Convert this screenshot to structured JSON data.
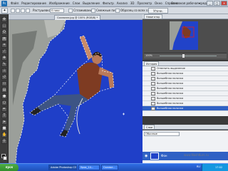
{
  "app": {
    "logo": "Ps",
    "menu": [
      "Файл",
      "Редактирование",
      "Изображение",
      "Слои",
      "Выделение",
      "Фильтр",
      "Анализ",
      "3D",
      "Просмотр",
      "Окно",
      "Справка"
    ],
    "workspace": "Основная рабочая среда",
    "window_buttons": [
      "_",
      "□",
      "×"
    ]
  },
  "options_bar": {
    "feather_label": "Растушевка:",
    "feather_value": "0 пикс",
    "antialias_label": "Сглаживание",
    "contiguous_label": "Смежные пикс.",
    "sample_all_label": "Образец со всех слоев",
    "refine_button": "Уточн. край..."
  },
  "document": {
    "tab_title": "Скалолаз.jpg @ 100% (RGB/8) *"
  },
  "navigator": {
    "tab": "Навигатор",
    "zoom": "100%"
  },
  "history": {
    "tab": "История",
    "items": [
      "Отменить выделение",
      "Волшебная палочка",
      "Волшебная палочка",
      "Волшебная палочка",
      "Волшебная палочка",
      "Волшебная палочка",
      "Волшебная палочка",
      "Волшебная палочка",
      "Волшебная палочка"
    ],
    "active_index": 8
  },
  "layers": {
    "tab": "Слои",
    "blend": "Обычные",
    "layer_name": "Фон"
  },
  "watermark": "www.NashKurs.ru",
  "taskbar": {
    "start": "пуск",
    "tasks": [
      "Adobe Photoshop CS...",
      "Урок_14...",
      "Скалол..."
    ],
    "active_index": 0,
    "language": "RU",
    "time": "17:02"
  }
}
